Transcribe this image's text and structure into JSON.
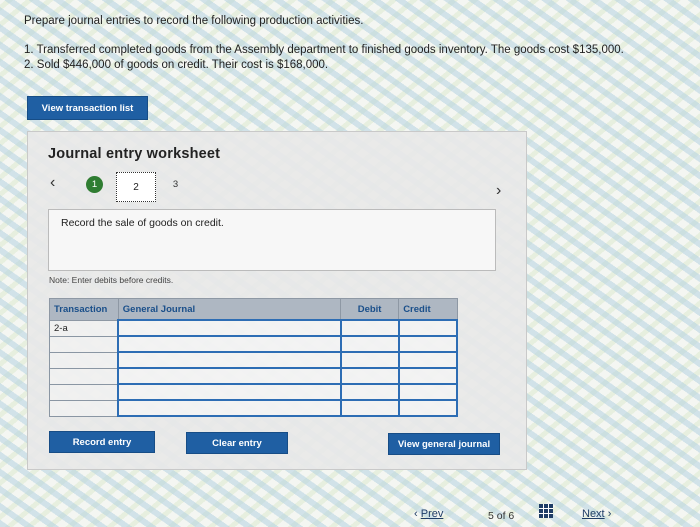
{
  "instructions": {
    "heading": "Prepare journal entries to record the following production activities.",
    "item1": "1. Transferred completed goods from the Assembly department to finished goods inventory. The goods cost $135,000.",
    "item2": "2. Sold $446,000 of goods on credit. Their cost is $168,000."
  },
  "buttons": {
    "view_transaction_list": "View transaction list",
    "record_entry": "Record entry",
    "clear_entry": "Clear entry",
    "view_general_journal": "View general journal"
  },
  "worksheet": {
    "title": "Journal entry worksheet",
    "steps": [
      "1",
      "2",
      "3"
    ],
    "prompt": "Record the sale of goods on credit.",
    "note": "Note: Enter debits before credits."
  },
  "table": {
    "headers": [
      "Transaction",
      "General Journal",
      "Debit",
      "Credit"
    ],
    "rows": [
      [
        "2-a",
        "",
        "",
        ""
      ],
      [
        "",
        "",
        "",
        ""
      ],
      [
        "",
        "",
        "",
        ""
      ],
      [
        "",
        "",
        "",
        ""
      ],
      [
        "",
        "",
        "",
        ""
      ],
      [
        "",
        "",
        "",
        ""
      ]
    ]
  },
  "footer": {
    "prev": "Prev",
    "page": "5 of 6",
    "next": "Next"
  },
  "icons": {
    "prev": "chevron-left-icon",
    "next": "chevron-right-icon",
    "grid": "grid-icon"
  },
  "colors": {
    "button": "#1f5fa3",
    "step_done": "#2f7d32",
    "header_text": "#1a4f8a"
  }
}
